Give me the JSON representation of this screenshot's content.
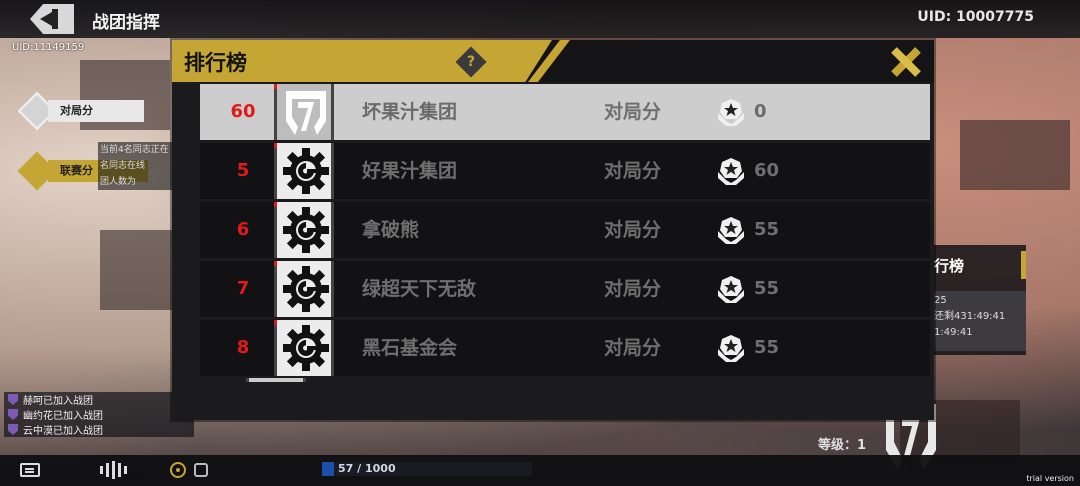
{
  "header": {
    "title": "战团指挥",
    "uid": "UID: 10007775"
  },
  "left_uid": "UID:11149159",
  "side_tabs": [
    {
      "label": "对局分",
      "selected": true
    },
    {
      "label": "联赛分",
      "selected": false
    }
  ],
  "left_info_lines": [
    "当前4名同志正在",
    "名同志在线",
    "团人数为"
  ],
  "notifications": [
    "赫呵已加入战团",
    "幽约花已加入战团",
    "云中漠已加入战团"
  ],
  "progress": {
    "text": "57 / 1000",
    "value": 57,
    "max": 1000
  },
  "trial_text": "trial version",
  "right_panel": {
    "title": "行榜",
    "lines": [
      "25",
      "还剩431:49:41",
      "1:49:41"
    ]
  },
  "level_text": "等级：1",
  "modal": {
    "title": "排行榜",
    "help_glyph": "?",
    "rows": [
      {
        "rank": "60",
        "name": "坏果汁集团",
        "score_label": "对局分",
        "score": "0",
        "highlighted": true,
        "emblem": "seven-emblem"
      },
      {
        "rank": "5",
        "name": "好果汁集团",
        "score_label": "对局分",
        "score": "60",
        "highlighted": false,
        "emblem": "gear-emblem"
      },
      {
        "rank": "6",
        "name": "拿破熊",
        "score_label": "对局分",
        "score": "55",
        "highlighted": false,
        "emblem": "gear-emblem"
      },
      {
        "rank": "7",
        "name": "绿超天下无敌",
        "score_label": "对局分",
        "score": "55",
        "highlighted": false,
        "emblem": "gear-emblem"
      },
      {
        "rank": "8",
        "name": "黑石基金会",
        "score_label": "对局分",
        "score": "55",
        "highlighted": false,
        "emblem": "gear-emblem"
      }
    ]
  },
  "colors": {
    "accent": "#c5a634",
    "rank_red": "#e01a1a",
    "panel": "#1b1b1e",
    "highlight_row": "#cdcdcd"
  }
}
